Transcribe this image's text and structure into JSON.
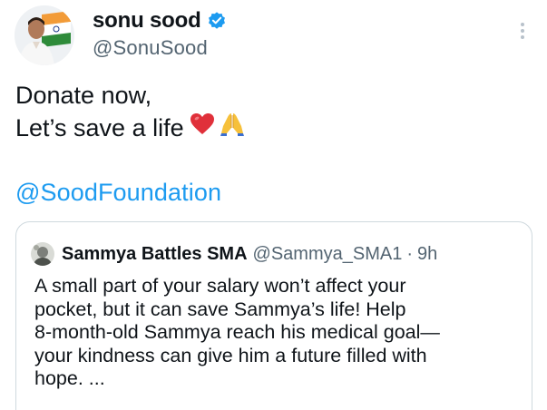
{
  "tweet": {
    "author": {
      "display_name": "sonu sood",
      "handle": "@SonuSood",
      "verified": true
    },
    "body_lines": [
      "Donate now,",
      "Let’s save a life"
    ],
    "emojis": [
      "red-heart",
      "folded-hands"
    ],
    "mention": "@SoodFoundation",
    "more_icon": "more-vertical-icon"
  },
  "quote": {
    "display_name": "Sammya Battles SMA",
    "handle": "@Sammya_SMA1",
    "separator": "·",
    "time": "9h",
    "text_lines": [
      "A small part of your salary won’t affect your",
      "pocket, but it can save Sammya’s life! Help",
      "8-month-old Sammya reach his medical goal—",
      "your kindness can give him a future filled with",
      "hope. ..."
    ]
  },
  "colors": {
    "link": "#1d9bf0",
    "secondary_text": "#536471",
    "border": "#cfd9de",
    "verified_badge": "#1d9bf0"
  }
}
